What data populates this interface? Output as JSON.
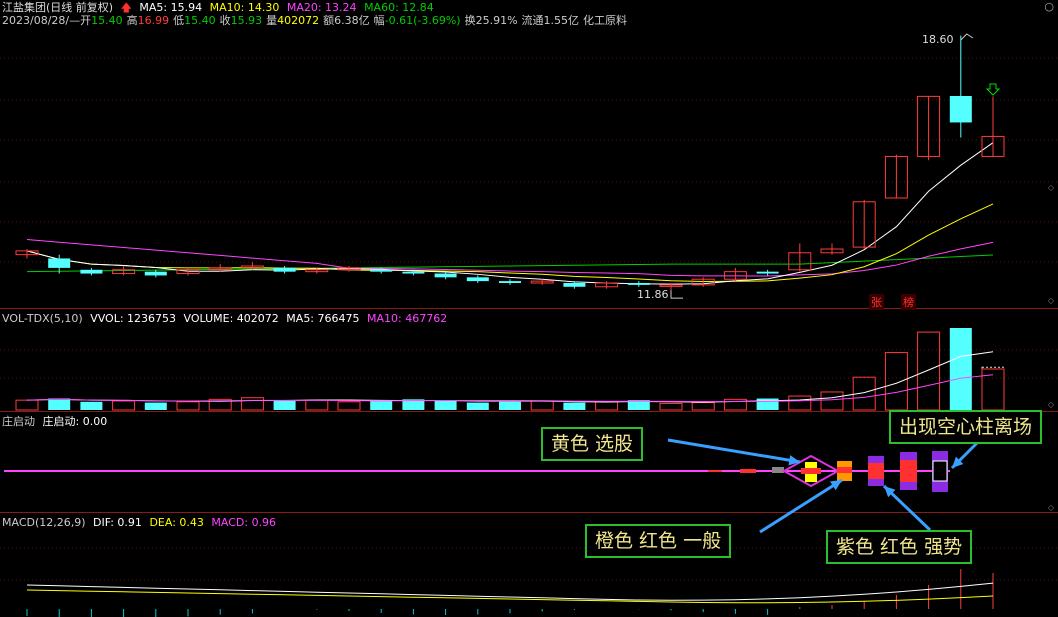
{
  "header": {
    "title": "江盐集团(日线 前复权)",
    "ma5": "MA5: 15.94",
    "ma10": "MA10: 14.30",
    "ma20": "MA20: 13.24",
    "ma60": "MA60: 12.84",
    "date_line": "2023/08/28/—",
    "open_label": "开",
    "open": "15.40",
    "high_label": "高",
    "high": "16.99",
    "low_label": "低",
    "low": "15.40",
    "close_label": "收",
    "close": "15.93",
    "vol_label": "量",
    "vol": "402072",
    "amount": "额6.38亿",
    "change_label": "幅",
    "change": "-0.61(-3.69%)",
    "turnover": "换25.91%",
    "float_shares": "流通1.55亿",
    "industry": "化工原料"
  },
  "corner_icon": "○",
  "price_high_label": "18.60",
  "price_low_label": "11.86",
  "price_tags": [
    "张",
    "榜"
  ],
  "vol_panel": {
    "title": "VOL-TDX(5,10)",
    "vvol": "VVOL: 1236753",
    "volume": "VOLUME: 402072",
    "ma5": "MA5: 766475",
    "ma10": "MA10: 467762"
  },
  "zhuang_panel": {
    "title": "庄启动",
    "value": "庄启动: 0.00"
  },
  "macd_panel": {
    "title": "MACD(12,26,9)",
    "dif": "DIF: 0.91",
    "dea": "DEA: 0.43",
    "macd": "MACD: 0.96"
  },
  "callouts": {
    "yellow": "黄色  选股",
    "orange": "橙色 红色   一般",
    "purple": "紫色 红色   强势",
    "hollow": "出现空心柱离场"
  },
  "colors": {
    "up": "#ff3c3c",
    "down": "#54ffff",
    "ma5": "#ffffff",
    "ma10": "#ffff00",
    "ma20": "#ff44ff",
    "ma60": "#00cc00",
    "border": "#8b1a1a",
    "callout_border": "#2bbf2b",
    "callout_text": "#f0e68c",
    "arrow": "#3aa0ff"
  },
  "chart_data": {
    "type": "candlestick",
    "candles": [
      {
        "o": 12.8,
        "c": 12.9,
        "h": 12.95,
        "l": 12.7
      },
      {
        "o": 12.7,
        "c": 12.45,
        "h": 12.8,
        "l": 12.3
      },
      {
        "o": 12.4,
        "c": 12.3,
        "h": 12.45,
        "l": 12.25
      },
      {
        "o": 12.3,
        "c": 12.4,
        "h": 12.5,
        "l": 12.25
      },
      {
        "o": 12.35,
        "c": 12.25,
        "h": 12.4,
        "l": 12.2
      },
      {
        "o": 12.3,
        "c": 12.4,
        "h": 12.45,
        "l": 12.25
      },
      {
        "o": 12.4,
        "c": 12.45,
        "h": 12.55,
        "l": 12.35
      },
      {
        "o": 12.45,
        "c": 12.5,
        "h": 12.6,
        "l": 12.4
      },
      {
        "o": 12.45,
        "c": 12.35,
        "h": 12.5,
        "l": 12.3
      },
      {
        "o": 12.35,
        "c": 12.4,
        "h": 12.45,
        "l": 12.3
      },
      {
        "o": 12.4,
        "c": 12.45,
        "h": 12.5,
        "l": 12.35
      },
      {
        "o": 12.4,
        "c": 12.35,
        "h": 12.45,
        "l": 12.3
      },
      {
        "o": 12.35,
        "c": 12.3,
        "h": 12.4,
        "l": 12.25
      },
      {
        "o": 12.3,
        "c": 12.2,
        "h": 12.35,
        "l": 12.15
      },
      {
        "o": 12.2,
        "c": 12.1,
        "h": 12.25,
        "l": 12.05
      },
      {
        "o": 12.1,
        "c": 12.05,
        "h": 12.15,
        "l": 12.0
      },
      {
        "o": 12.05,
        "c": 12.1,
        "h": 12.15,
        "l": 12.0
      },
      {
        "o": 12.05,
        "c": 11.95,
        "h": 12.1,
        "l": 11.9
      },
      {
        "o": 11.95,
        "c": 12.05,
        "h": 12.1,
        "l": 11.9
      },
      {
        "o": 12.05,
        "c": 12.0,
        "h": 12.1,
        "l": 11.95
      },
      {
        "o": 11.98,
        "c": 12.0,
        "h": 12.05,
        "l": 11.86
      },
      {
        "o": 12.0,
        "c": 12.15,
        "h": 12.2,
        "l": 11.95
      },
      {
        "o": 12.15,
        "c": 12.35,
        "h": 12.45,
        "l": 12.1
      },
      {
        "o": 12.35,
        "c": 12.3,
        "h": 12.4,
        "l": 12.25
      },
      {
        "o": 12.4,
        "c": 12.85,
        "h": 13.1,
        "l": 12.35
      },
      {
        "o": 12.85,
        "c": 12.95,
        "h": 13.1,
        "l": 12.8
      },
      {
        "o": 13.0,
        "c": 14.2,
        "h": 14.25,
        "l": 12.95
      },
      {
        "o": 14.3,
        "c": 15.4,
        "h": 15.45,
        "l": 14.3
      },
      {
        "o": 15.4,
        "c": 16.99,
        "h": 16.99,
        "l": 15.3
      },
      {
        "o": 17.0,
        "c": 16.3,
        "h": 18.6,
        "l": 15.9
      },
      {
        "o": 15.4,
        "c": 15.93,
        "h": 16.99,
        "l": 15.4
      }
    ],
    "volume": [
      12,
      14,
      10,
      11,
      9,
      10,
      13,
      15,
      11,
      12,
      10,
      11,
      13,
      12,
      9,
      10,
      11,
      9,
      10,
      12,
      8,
      9,
      13,
      14,
      17,
      22,
      40,
      70,
      95,
      100,
      50
    ],
    "ylim": [
      11.6,
      18.8
    ]
  }
}
